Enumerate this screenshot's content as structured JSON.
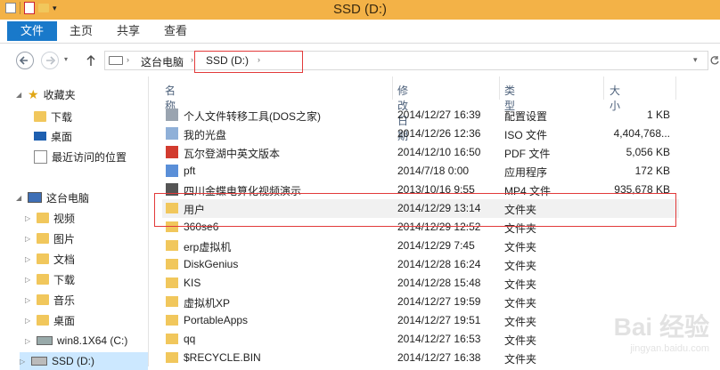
{
  "window": {
    "title": "SSD (D:)"
  },
  "ribbon": {
    "tabs": [
      {
        "label": "文件"
      },
      {
        "label": "主页"
      },
      {
        "label": "共享"
      },
      {
        "label": "查看"
      }
    ]
  },
  "address": {
    "path": [
      "这台电脑",
      "SSD (D:)"
    ]
  },
  "sidebar": {
    "favorites_label": "收藏夹",
    "favorites": [
      {
        "label": "下载"
      },
      {
        "label": "桌面"
      },
      {
        "label": "最近访问的位置"
      }
    ],
    "pc_label": "这台电脑",
    "pc_items": [
      {
        "label": "视频"
      },
      {
        "label": "图片"
      },
      {
        "label": "文档"
      },
      {
        "label": "下载"
      },
      {
        "label": "音乐"
      },
      {
        "label": "桌面"
      },
      {
        "label": "win8.1X64 (C:)"
      },
      {
        "label": "SSD (D:)"
      }
    ]
  },
  "columns": {
    "name": "名称",
    "date": "修改日期",
    "type": "类型",
    "size": "大小"
  },
  "files": [
    {
      "name": "个人文件转移工具(DOS之家)",
      "date": "2014/12/27 16:39",
      "type": "配置设置",
      "size": "1 KB",
      "icon": "settings-file-icon"
    },
    {
      "name": "我的光盘",
      "date": "2014/12/26 12:36",
      "type": "ISO 文件",
      "size": "4,404,768...",
      "icon": "disc-image-icon"
    },
    {
      "name": "瓦尔登湖中英文版本",
      "date": "2014/12/10 16:50",
      "type": "PDF 文件",
      "size": "5,056 KB",
      "icon": "pdf-icon"
    },
    {
      "name": "pft",
      "date": "2014/7/18 0:00",
      "type": "应用程序",
      "size": "172 KB",
      "icon": "app-icon"
    },
    {
      "name": "四川金蝶电算化视频演示",
      "date": "2013/10/16 9:55",
      "type": "MP4 文件",
      "size": "935,678 KB",
      "icon": "video-file-icon"
    },
    {
      "name": "用户",
      "date": "2014/12/29 13:14",
      "type": "文件夹",
      "size": "",
      "icon": "folder-icon"
    },
    {
      "name": "360se6",
      "date": "2014/12/29 12:52",
      "type": "文件夹",
      "size": "",
      "icon": "folder-icon"
    },
    {
      "name": "erp虚拟机",
      "date": "2014/12/29 7:45",
      "type": "文件夹",
      "size": "",
      "icon": "folder-icon"
    },
    {
      "name": "DiskGenius",
      "date": "2014/12/28 16:24",
      "type": "文件夹",
      "size": "",
      "icon": "folder-icon"
    },
    {
      "name": "KIS",
      "date": "2014/12/28 15:48",
      "type": "文件夹",
      "size": "",
      "icon": "folder-icon"
    },
    {
      "name": "虚拟机XP",
      "date": "2014/12/27 19:59",
      "type": "文件夹",
      "size": "",
      "icon": "folder-icon"
    },
    {
      "name": "PortableApps",
      "date": "2014/12/27 19:51",
      "type": "文件夹",
      "size": "",
      "icon": "folder-icon"
    },
    {
      "name": "qq",
      "date": "2014/12/27 16:53",
      "type": "文件夹",
      "size": "",
      "icon": "folder-icon"
    },
    {
      "name": "$RECYCLE.BIN",
      "date": "2014/12/27 16:38",
      "type": "文件夹",
      "size": "",
      "icon": "folder-icon"
    }
  ],
  "watermark": {
    "text": "Bai 经验",
    "sub": "jingyan.baidu.com"
  },
  "colors": {
    "file_tab": "#1979ca",
    "titlebar": "#f3b247",
    "selection": "#cce8ff",
    "highlight_box": "#e23a3a"
  }
}
